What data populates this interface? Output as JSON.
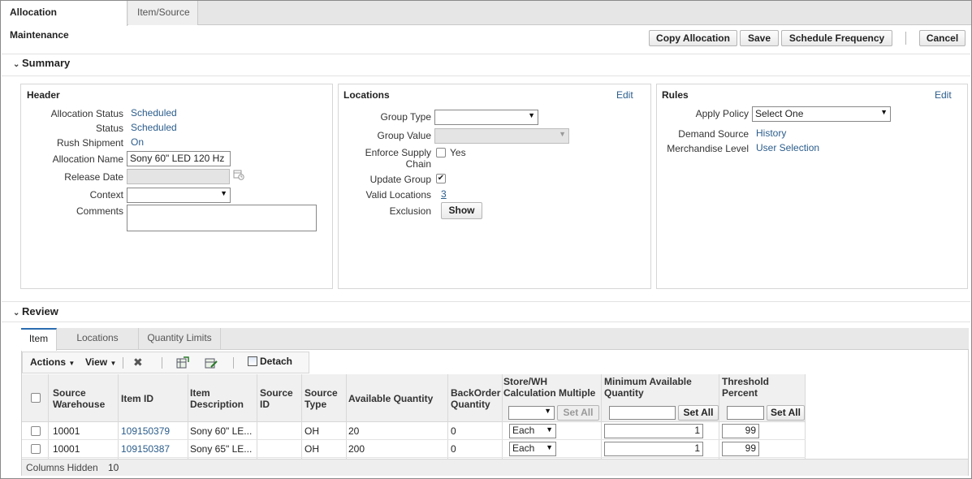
{
  "tabs": [
    "Allocation Maintenance",
    "Item/Source"
  ],
  "toolbar": {
    "copy_allocation": "Copy Allocation",
    "save": "Save",
    "schedule_frequency": "Schedule Frequency",
    "cancel": "Cancel"
  },
  "summary": {
    "title": "Summary",
    "header": {
      "title": "Header",
      "allocation_status_label": "Allocation Status",
      "allocation_status_value": "Scheduled",
      "status_label": "Status",
      "status_value": "Scheduled",
      "rush_shipment_label": "Rush Shipment",
      "rush_shipment_value": "On",
      "allocation_name_label": "Allocation Name",
      "allocation_name_value": "Sony 60\" LED 120 Hz",
      "release_date_label": "Release Date",
      "context_label": "Context",
      "comments_label": "Comments"
    },
    "locations": {
      "title": "Locations",
      "edit": "Edit",
      "group_type_label": "Group Type",
      "group_value_label": "Group Value",
      "enforce_supply_chain_label_1": "Enforce Supply",
      "enforce_supply_chain_label_2": "Chain",
      "enforce_supply_chain_option": "Yes",
      "update_group_label": "Update Group",
      "valid_locations_label": "Valid Locations",
      "valid_locations_value": "3",
      "exclusion_label": "Exclusion",
      "show_button": "Show"
    },
    "rules": {
      "title": "Rules",
      "edit": "Edit",
      "apply_policy_label": "Apply Policy",
      "apply_policy_value": "Select One",
      "demand_source_label": "Demand Source",
      "demand_source_value": "History",
      "merchandise_level_label": "Merchandise Level",
      "merchandise_level_value": "User Selection"
    }
  },
  "review": {
    "title": "Review",
    "tabs": [
      "Item",
      "Locations",
      "Quantity Limits"
    ],
    "actions_label": "Actions",
    "view_label": "View",
    "detach_label": "Detach",
    "columns": {
      "source_warehouse_1": "Source",
      "source_warehouse_2": "Warehouse",
      "item_id": "Item ID",
      "item_description_1": "Item",
      "item_description_2": "Description",
      "source_id_1": "Source",
      "source_id_2": "ID",
      "source_type_1": "Source",
      "source_type_2": "Type",
      "available_quantity": "Available Quantity",
      "backorder_1": "BackOrder",
      "backorder_2": "Quantity",
      "store_wh_1": "Store/WH",
      "store_wh_2": "Calculation Multiple",
      "min_avail_1": "Minimum Available",
      "min_avail_2": "Quantity",
      "threshold_1": "Threshold",
      "threshold_2": "Percent"
    },
    "set_all": "Set All",
    "rows": [
      {
        "source_warehouse": "10001",
        "item_id": "109150379",
        "item_description": "Sony 60\" LE...",
        "source_id": "",
        "source_type": "OH",
        "available_quantity": "20",
        "backorder_quantity": "0",
        "calc_multiple": "Each",
        "min_available": "1",
        "threshold": "99"
      },
      {
        "source_warehouse": "10001",
        "item_id": "109150387",
        "item_description": "Sony 65\" LE...",
        "source_id": "",
        "source_type": "OH",
        "available_quantity": "200",
        "backorder_quantity": "0",
        "calc_multiple": "Each",
        "min_available": "1",
        "threshold": "99"
      }
    ],
    "columns_hidden_label": "Columns Hidden",
    "columns_hidden_value": "10"
  },
  "colors": {
    "link": "#2b5d8c",
    "tab_accent": "#2b6cb0"
  }
}
